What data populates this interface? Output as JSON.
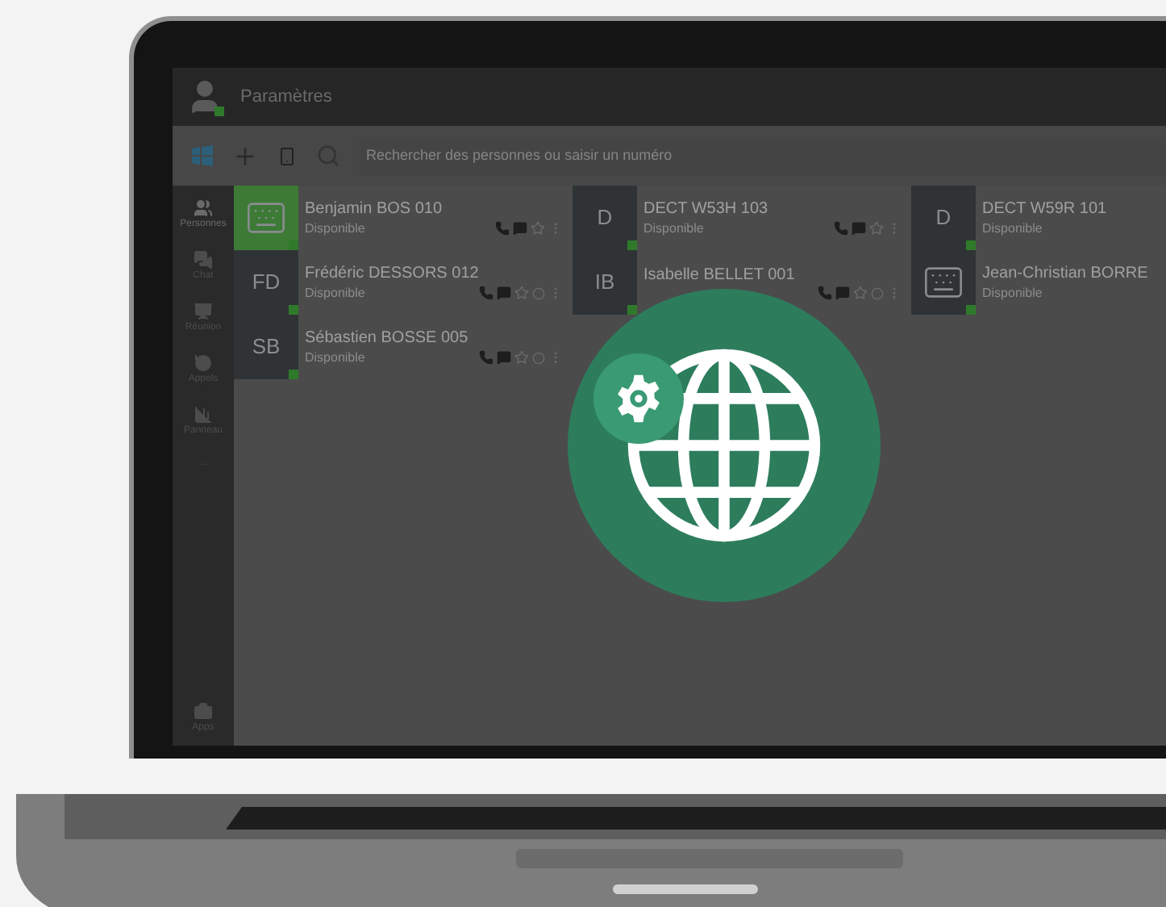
{
  "window": {
    "title": "Paramètres"
  },
  "toolbar": {
    "search": {
      "placeholder": "Rechercher des personnes ou saisir un numéro"
    }
  },
  "sidebar": {
    "items": [
      {
        "label": "Personnes",
        "selected": true
      },
      {
        "label": "Chat",
        "selected": false
      },
      {
        "label": "Réunion",
        "selected": false
      },
      {
        "label": "Appels",
        "selected": false
      },
      {
        "label": "Panneau",
        "selected": false
      },
      {
        "label": "...",
        "selected": false
      }
    ],
    "bottom": {
      "label": "Apps"
    }
  },
  "contacts": [
    {
      "name": "Benjamin BOS 010",
      "status": "Disponible",
      "avatar": {
        "kind": "device",
        "color": "#3d7a36"
      },
      "extra_action": false
    },
    {
      "name": "DECT W53H 103",
      "status": "Disponible",
      "avatar": {
        "kind": "initials",
        "text": "D",
        "color": "#2f3336"
      },
      "extra_action": false
    },
    {
      "name": "DECT W59R 101",
      "status": "Disponible",
      "avatar": {
        "kind": "initials",
        "text": "D",
        "color": "#2f3336"
      },
      "extra_action": false
    },
    {
      "name": "Frédéric DESSORS 012",
      "status": "Disponible",
      "avatar": {
        "kind": "initials",
        "text": "FD",
        "color": "#2f3336"
      },
      "extra_action": true
    },
    {
      "name": "Isabelle BELLET 001",
      "avatar": {
        "kind": "initials",
        "text": "IB",
        "color": "#2f3336"
      },
      "extra_action": true
    },
    {
      "name": "Jean-Christian BORRE",
      "status": "Disponible",
      "avatar": {
        "kind": "device",
        "color": "#2f3336"
      },
      "extra_action": false
    },
    {
      "name": "Sébastien BOSSE 005",
      "status": "Disponible",
      "avatar": {
        "kind": "initials",
        "text": "SB",
        "color": "#2f3336"
      },
      "extra_action": true
    }
  ]
}
